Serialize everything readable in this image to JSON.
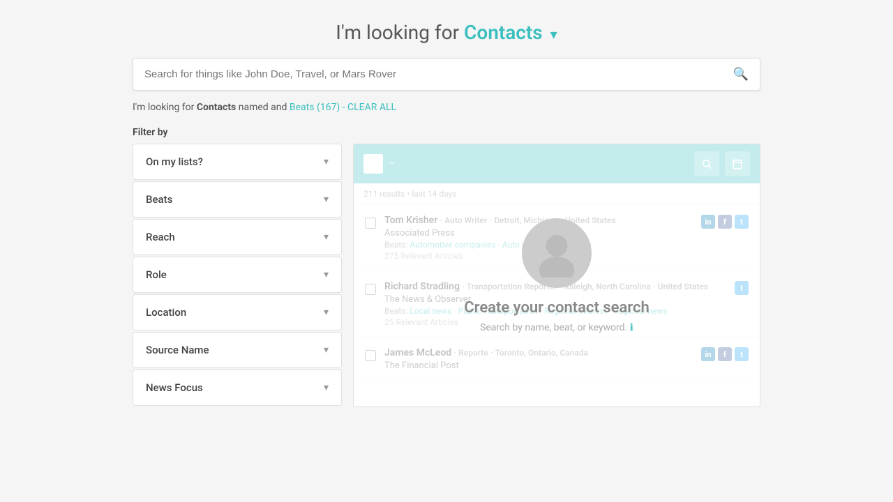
{
  "header": {
    "title_prefix": "I'm looking for",
    "title_highlight": "Contacts",
    "dropdown_arrow": "▾"
  },
  "search": {
    "placeholder": "Search for things like John Doe, Travel, or Mars Rover",
    "icon": "🔍"
  },
  "filter_description": {
    "prefix": "I'm looking for",
    "bold_text": "Contacts",
    "middle": "named and",
    "link_text": "Beats (167) - CLEAR ALL"
  },
  "filter_by_label": "Filter by",
  "filters": [
    {
      "id": "on-my-lists",
      "label": "On my lists?"
    },
    {
      "id": "beats",
      "label": "Beats"
    },
    {
      "id": "reach",
      "label": "Reach"
    },
    {
      "id": "role",
      "label": "Role"
    },
    {
      "id": "location",
      "label": "Location"
    },
    {
      "id": "source-name",
      "label": "Source Name"
    },
    {
      "id": "news-focus",
      "label": "News Focus"
    }
  ],
  "results": {
    "meta": "211 results  •  last 14 days",
    "toolbar": {
      "search_icon": "🔍",
      "calendar_icon": "📅"
    },
    "contacts": [
      {
        "id": 1,
        "name": "Tom Krisher",
        "role": "Auto Writer",
        "city": "Detroit, Michigan",
        "country": "United States",
        "source": "Associated Press",
        "beats": "Automotive companies · Auto parts · Road safety",
        "articles": "275 Relevant Articles",
        "social": [
          "li",
          "fb",
          "tw"
        ]
      },
      {
        "id": 2,
        "name": "Richard Stradling",
        "role": "Transportation Reporter",
        "city": "Raleigh, North Carolina",
        "country": "United States",
        "source": "The News & Observer",
        "beats": "Local news · Public Transportation · Regional interest · Regional news",
        "articles": "25 Relevant Articles",
        "social": [
          "tw"
        ]
      },
      {
        "id": 3,
        "name": "James McLeod",
        "role": "Reporte",
        "city": "Toronto, Ontario, Canada",
        "country": "",
        "source": "The Financial Post",
        "beats": "",
        "articles": "",
        "social": [
          "li",
          "fb",
          "tw"
        ]
      }
    ]
  },
  "overlay": {
    "title": "Create your contact search",
    "subtitle": "Search by name, beat, or keyword.",
    "info_icon": "ℹ"
  }
}
